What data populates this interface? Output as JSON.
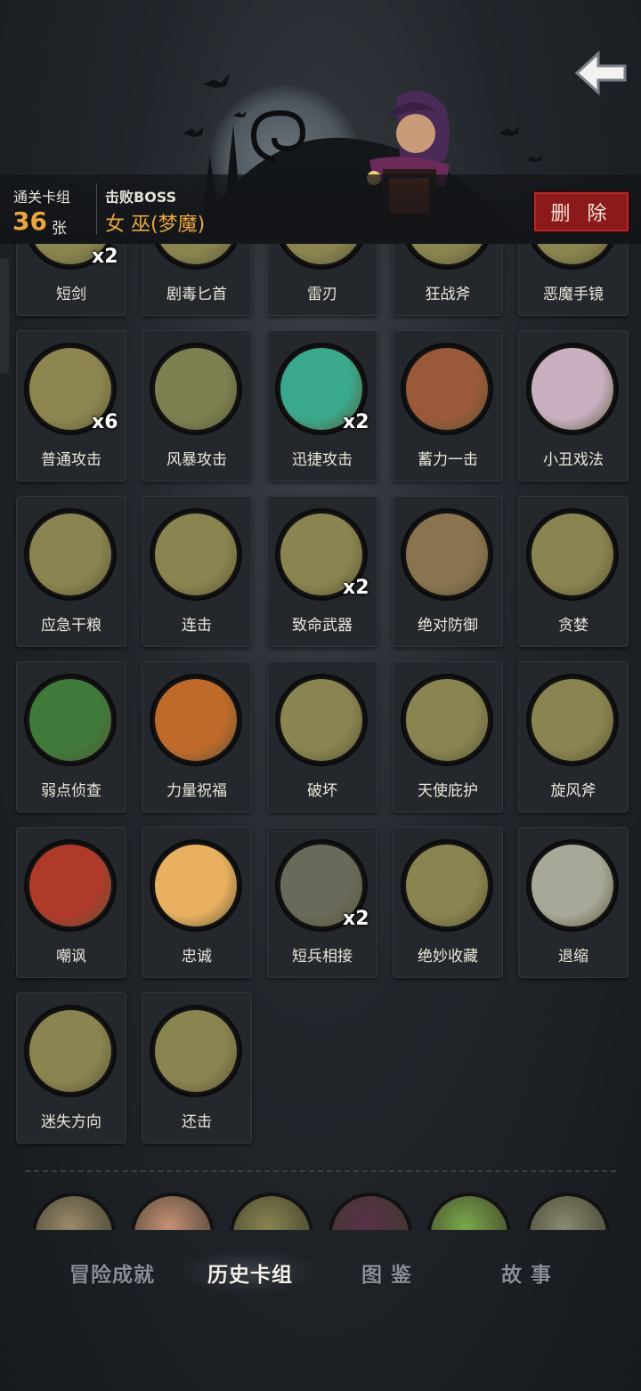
{
  "header": {
    "cleared_label": "通关卡组",
    "cleared_count": "36",
    "cleared_unit": "张",
    "boss_label": "击败BOSS",
    "boss_name": "女 巫(梦魔)",
    "delete_label": "删 除"
  },
  "cards": [
    {
      "name": "短剑",
      "count": "x2",
      "color": "#8a8450",
      "icon": "dagger-icon"
    },
    {
      "name": "剧毒匕首",
      "count": "",
      "color": "#8a8450",
      "icon": "poison-dagger-icon"
    },
    {
      "name": "雷刃",
      "count": "",
      "color": "#8a8450",
      "icon": "thunder-blade-icon"
    },
    {
      "name": "狂战斧",
      "count": "",
      "color": "#8a8450",
      "icon": "berserker-axe-icon"
    },
    {
      "name": "恶魔手镜",
      "count": "",
      "color": "#8a8450",
      "icon": "demon-mirror-icon"
    },
    {
      "name": "普通攻击",
      "count": "x6",
      "color": "#8e8650",
      "icon": "sword-icon"
    },
    {
      "name": "风暴攻击",
      "count": "",
      "color": "#7e8052",
      "icon": "storm-icon"
    },
    {
      "name": "迅捷攻击",
      "count": "x2",
      "color": "#3aa88c",
      "icon": "swift-gauntlet-icon"
    },
    {
      "name": "蓄力一击",
      "count": "",
      "color": "#9a5a3a",
      "icon": "hammer-icon"
    },
    {
      "name": "小丑戏法",
      "count": "",
      "color": "#c8b0c0",
      "icon": "clown-icon"
    },
    {
      "name": "应急干粮",
      "count": "",
      "color": "#8a8450",
      "icon": "rations-icon"
    },
    {
      "name": "连击",
      "count": "",
      "color": "#8a8450",
      "icon": "archer-icon"
    },
    {
      "name": "致命武器",
      "count": "x2",
      "color": "#8a8450",
      "icon": "weapons-icon"
    },
    {
      "name": "绝对防御",
      "count": "",
      "color": "#8a7450",
      "icon": "shield-dwarf-icon"
    },
    {
      "name": "贪婪",
      "count": "",
      "color": "#8a8450",
      "icon": "goblin-icon"
    },
    {
      "name": "弱点侦查",
      "count": "",
      "color": "#3f7a3a",
      "icon": "wolf-icon"
    },
    {
      "name": "力量祝福",
      "count": "",
      "color": "#c06a2a",
      "icon": "fist-icon"
    },
    {
      "name": "破坏",
      "count": "",
      "color": "#8a8450",
      "icon": "break-icon"
    },
    {
      "name": "天使庇护",
      "count": "",
      "color": "#8a8450",
      "icon": "angel-crown-icon"
    },
    {
      "name": "旋风斧",
      "count": "",
      "color": "#8a8450",
      "icon": "whirl-axe-icon"
    },
    {
      "name": "嘲讽",
      "count": "",
      "color": "#b03a2a",
      "icon": "taunt-icon"
    },
    {
      "name": "忠诚",
      "count": "",
      "color": "#e8b060",
      "icon": "cross-icon"
    },
    {
      "name": "短兵相接",
      "count": "x2",
      "color": "#6a6a5a",
      "icon": "knight-icon"
    },
    {
      "name": "绝妙收藏",
      "count": "",
      "color": "#8a8450",
      "icon": "collection-icon"
    },
    {
      "name": "退缩",
      "count": "",
      "color": "#a8a898",
      "icon": "retreat-icon"
    },
    {
      "name": "迷失方向",
      "count": "",
      "color": "#8a8450",
      "icon": "signpost-icon"
    },
    {
      "name": "还击",
      "count": "",
      "color": "#8a8450",
      "icon": "counter-icon"
    }
  ],
  "thumbnails": [
    {
      "color": "#9a8a6a",
      "icon": "thumb-1-icon"
    },
    {
      "color": "#c89078",
      "icon": "thumb-2-icon"
    },
    {
      "color": "#8a8450",
      "icon": "thumb-3-icon"
    },
    {
      "color": "#5a3048",
      "icon": "thumb-4-icon"
    },
    {
      "color": "#7aa84a",
      "icon": "thumb-5-icon"
    },
    {
      "color": "#8a8a70",
      "icon": "thumb-6-icon"
    }
  ],
  "tabs": [
    {
      "label": "冒险成就",
      "active": false
    },
    {
      "label": "历史卡组",
      "active": true
    },
    {
      "label": "图 鉴",
      "active": false
    },
    {
      "label": "故 事",
      "active": false
    }
  ]
}
